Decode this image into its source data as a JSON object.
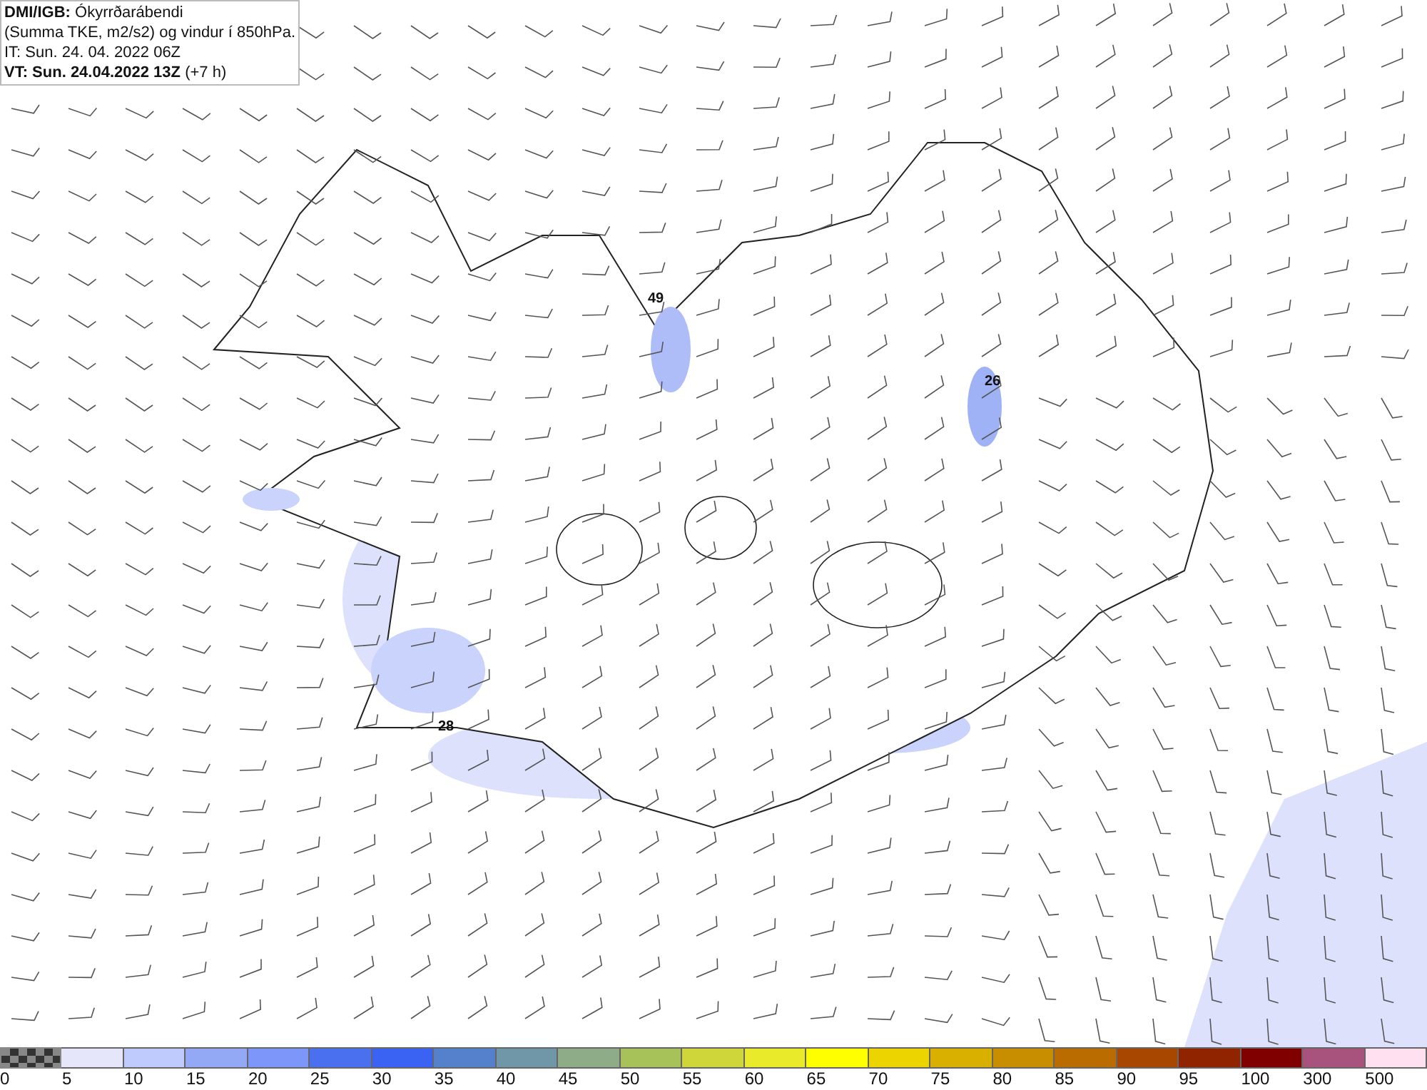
{
  "header": {
    "lines": [
      "**DMI/IGB:** Ókyrrðarábendi",
      "(Summa TKE, m2/s2) og vindur í 850hPa.",
      "IT: Sun. 24. 04. 2022 06Z",
      "**VT: Sun. 24.04.2022 13Z** (+7 h)"
    ]
  },
  "map": {
    "labels": [
      {
        "text": "49"
      },
      {
        "text": "26"
      },
      {
        "text": "28"
      }
    ]
  },
  "legend": {
    "items": [
      {
        "kind": "checker",
        "label": "0"
      },
      {
        "kind": "solid",
        "color": "#e6e6fa",
        "label": "5"
      },
      {
        "kind": "solid",
        "color": "#bfcbfd",
        "label": "10"
      },
      {
        "kind": "solid",
        "color": "#94a9f6",
        "label": "15"
      },
      {
        "kind": "solid",
        "color": "#7d96f9",
        "label": "20"
      },
      {
        "kind": "solid",
        "color": "#4a70f0",
        "label": "25"
      },
      {
        "kind": "solid",
        "color": "#3a63f3",
        "label": "30"
      },
      {
        "kind": "solid",
        "color": "#5580cc",
        "label": "35"
      },
      {
        "kind": "solid",
        "color": "#6f97a8",
        "label": "40"
      },
      {
        "kind": "solid",
        "color": "#8fac88",
        "label": "45"
      },
      {
        "kind": "solid",
        "color": "#a8c25a",
        "label": "50"
      },
      {
        "kind": "solid",
        "color": "#cfd63a",
        "label": "55"
      },
      {
        "kind": "solid",
        "color": "#e8ea2a",
        "label": "60"
      },
      {
        "kind": "solid",
        "color": "#ffff00",
        "label": "65"
      },
      {
        "kind": "solid",
        "color": "#ecd400",
        "label": "70"
      },
      {
        "kind": "solid",
        "color": "#dab000",
        "label": "75"
      },
      {
        "kind": "solid",
        "color": "#c98e00",
        "label": "80"
      },
      {
        "kind": "solid",
        "color": "#ba6c00",
        "label": "85"
      },
      {
        "kind": "solid",
        "color": "#a84800",
        "label": "90"
      },
      {
        "kind": "solid",
        "color": "#902400",
        "label": "95"
      },
      {
        "kind": "solid",
        "color": "#800000",
        "label": "100"
      },
      {
        "kind": "solid",
        "color": "#a8527e",
        "label": "300"
      },
      {
        "kind": "solid",
        "color": "#ffe0f0",
        "label": "500"
      }
    ]
  }
}
